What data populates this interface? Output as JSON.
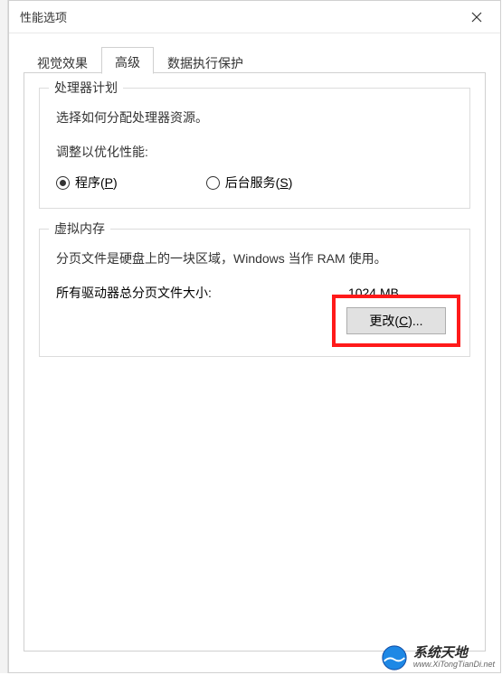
{
  "window": {
    "title": "性能选项"
  },
  "tabs": {
    "visual_effects": "视觉效果",
    "advanced": "高级",
    "dep": "数据执行保护"
  },
  "processor": {
    "legend": "处理器计划",
    "desc": "选择如何分配处理器资源。",
    "adjust_label": "调整以优化性能:",
    "radio_programs_pre": "程序(",
    "radio_programs_key": "P",
    "radio_programs_post": ")",
    "radio_services_pre": "后台服务(",
    "radio_services_key": "S",
    "radio_services_post": ")"
  },
  "vm": {
    "legend": "虚拟内存",
    "desc": "分页文件是硬盘上的一块区域，Windows 当作 RAM 使用。",
    "total_label": "所有驱动器总分页文件大小:",
    "total_value": "1024 MB",
    "change_pre": "更改(",
    "change_key": "C",
    "change_post": ")..."
  },
  "watermark": {
    "cn": "系统天地",
    "en": "www.XiTongTianDi.net"
  }
}
